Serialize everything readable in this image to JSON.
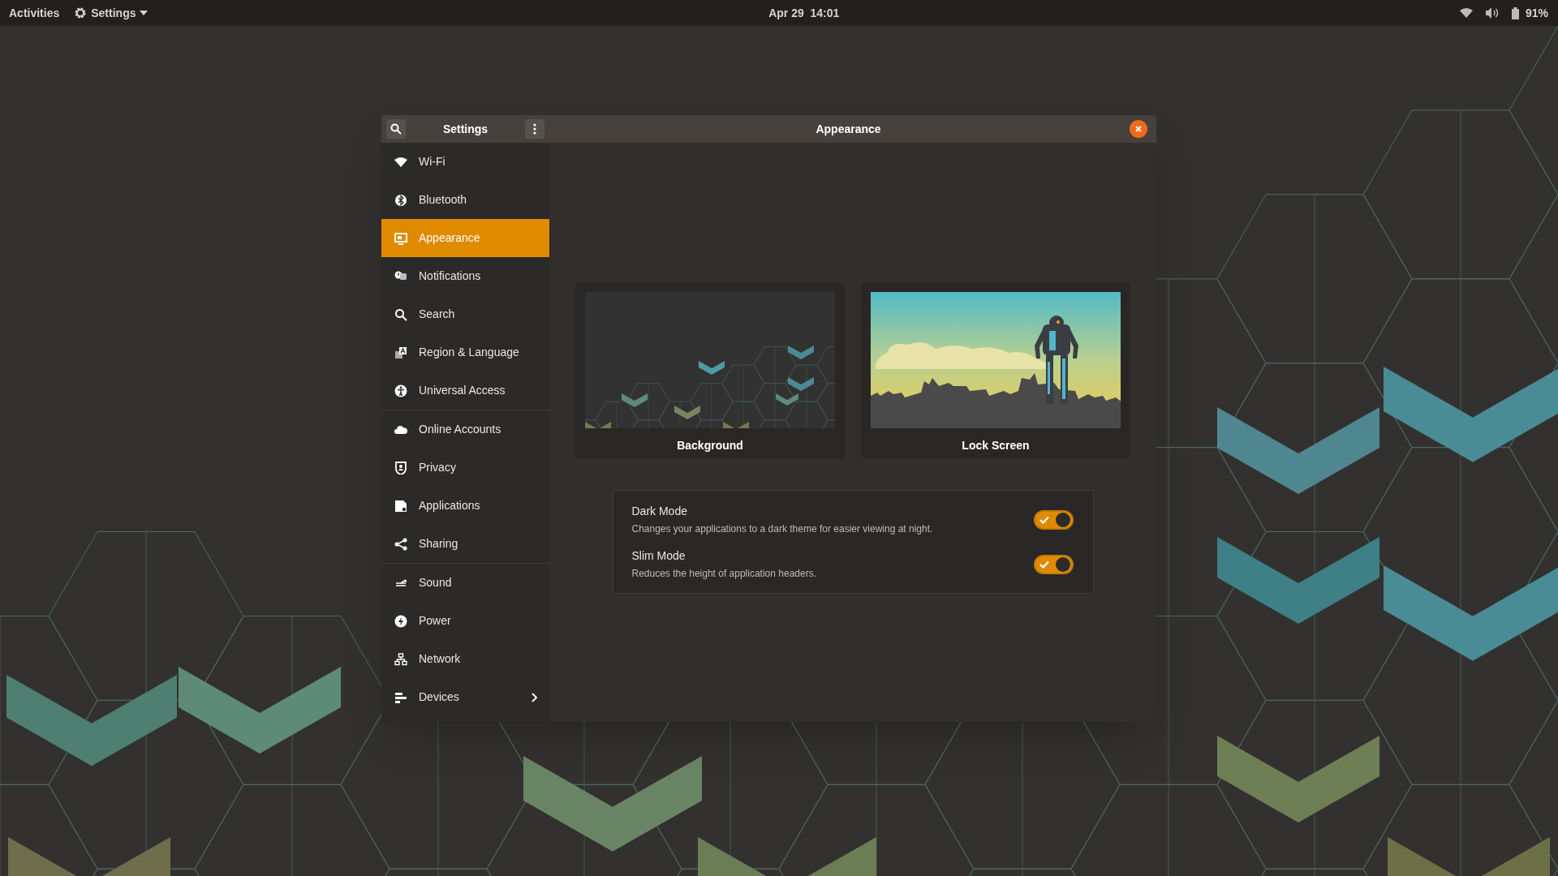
{
  "top_bar": {
    "activities": "Activities",
    "app_menu": "Settings",
    "clock": "Apr 29  14:01",
    "battery": "91%"
  },
  "window": {
    "sidebar_title": "Settings",
    "title": "Appearance"
  },
  "sidebar": {
    "groups": [
      {
        "items": [
          {
            "label": "Wi-Fi",
            "selected": false
          },
          {
            "label": "Bluetooth",
            "selected": false
          },
          {
            "label": "Appearance",
            "selected": true
          },
          {
            "label": "Notifications",
            "selected": false
          },
          {
            "label": "Search",
            "selected": false
          },
          {
            "label": "Region & Language",
            "selected": false
          },
          {
            "label": "Universal Access",
            "selected": false
          }
        ]
      },
      {
        "items": [
          {
            "label": "Online Accounts",
            "selected": false
          },
          {
            "label": "Privacy",
            "selected": false
          },
          {
            "label": "Applications",
            "selected": false
          },
          {
            "label": "Sharing",
            "selected": false
          }
        ]
      },
      {
        "items": [
          {
            "label": "Sound",
            "selected": false
          },
          {
            "label": "Power",
            "selected": false
          },
          {
            "label": "Network",
            "selected": false
          },
          {
            "label": "Devices",
            "selected": false,
            "has_submenu": true
          }
        ]
      }
    ]
  },
  "wallpapers": [
    {
      "kind": "pattern",
      "label": "Background"
    },
    {
      "kind": "robot",
      "label": "Lock Screen"
    }
  ],
  "options": [
    {
      "label": "Dark Mode",
      "description": "Changes your applications to a dark theme for easier viewing at night.",
      "checked": true
    },
    {
      "label": "Slim Mode",
      "description": "Reduces the height of application headers.",
      "checked": true
    }
  ]
}
